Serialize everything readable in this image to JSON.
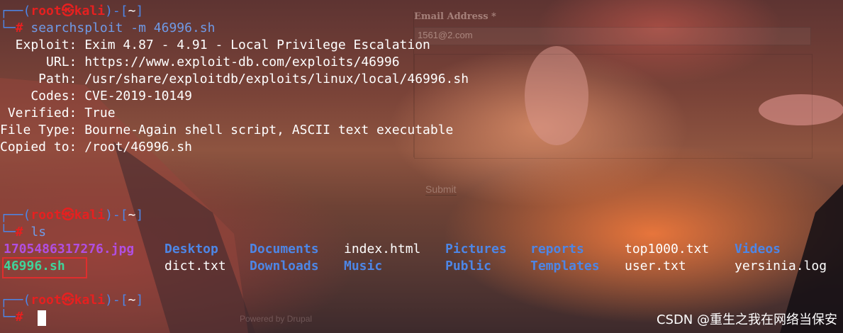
{
  "web_form": {
    "email_label": "Email Address *",
    "email_value": "1561@2.com",
    "submit_label": "Submit",
    "footer": "Powered by Drupal"
  },
  "prompts": {
    "user": "root",
    "at_symbol": "㉿",
    "host": "kali",
    "dir": "~",
    "hash": "#"
  },
  "command1": "searchsploit -m 46996.sh",
  "exploit_info": [
    {
      "key": "  Exploit: ",
      "value": "Exim 4.87 - 4.91 - Local Privilege Escalation"
    },
    {
      "key": "      URL: ",
      "value": "https://www.exploit-db.com/exploits/46996"
    },
    {
      "key": "     Path: ",
      "value": "/usr/share/exploitdb/exploits/linux/local/46996.sh"
    },
    {
      "key": "    Codes: ",
      "value": "CVE-2019-10149"
    },
    {
      "key": " Verified: ",
      "value": "True"
    },
    {
      "key": "File Type: ",
      "value": "Bourne-Again shell script, ASCII text executable"
    },
    {
      "key": "Copied to: ",
      "value": "/root/46996.sh"
    }
  ],
  "command2": "ls",
  "ls_output": [
    {
      "name": "1705486317276.jpg",
      "kind": "img"
    },
    {
      "name": "Desktop",
      "kind": "dir"
    },
    {
      "name": "Documents",
      "kind": "dir"
    },
    {
      "name": "index.html",
      "kind": "file"
    },
    {
      "name": "Pictures",
      "kind": "dir"
    },
    {
      "name": "reports",
      "kind": "dir"
    },
    {
      "name": "top1000.txt",
      "kind": "file"
    },
    {
      "name": "Videos",
      "kind": "dir"
    },
    {
      "name": "46996.sh",
      "kind": "exe"
    },
    {
      "name": "dict.txt",
      "kind": "file"
    },
    {
      "name": "Downloads",
      "kind": "dir"
    },
    {
      "name": "Music",
      "kind": "dir"
    },
    {
      "name": "Public",
      "kind": "dir"
    },
    {
      "name": "Templates",
      "kind": "dir"
    },
    {
      "name": "user.txt",
      "kind": "file"
    },
    {
      "name": "yersinia.log",
      "kind": "file"
    }
  ],
  "watermark": "CSDN @重生之我在网络当保安",
  "colors": {
    "prompt_frame": "#4d86e6",
    "prompt_user": "#e62020",
    "directory": "#4d86e6",
    "image_file": "#b04fe0",
    "executable": "#3fd49a",
    "highlight": "#e02d2d"
  }
}
